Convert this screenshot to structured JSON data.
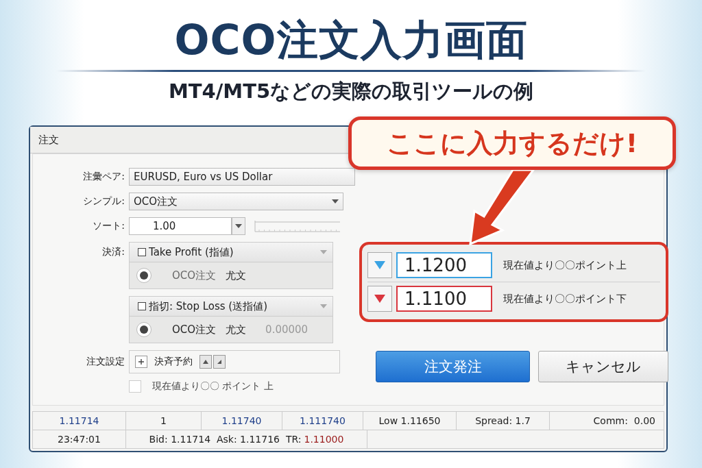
{
  "header": {
    "title": "OCO注文入力画面",
    "subtitle": "MT4/MT5などの実際の取引ツールの例"
  },
  "callout": {
    "text": "ここに入力するだけ!"
  },
  "dialog": {
    "title": "注文",
    "fields": [
      {
        "label": "注彙ペア:",
        "value": "EURUSD, Euro vs US Dollar",
        "kind": "text"
      },
      {
        "label": "シンプル:",
        "value": "OCO注文",
        "kind": "dropdown"
      },
      {
        "label": "ソート:",
        "value": "1.00",
        "kind": "spinner"
      }
    ],
    "settlement": {
      "label": "決済:",
      "groups": [
        {
          "checkbox_label": "Take Profit (指値)",
          "checked": false,
          "radio_selected": true,
          "texts": [
            "OCO注文",
            "尤文"
          ]
        },
        {
          "checkbox_label": "指切: Stop Loss (送指値)",
          "checked": false,
          "radio_selected": true,
          "texts": [
            "OCO注文",
            "尤文",
            "0.00000"
          ]
        }
      ]
    },
    "order_settings": {
      "label": "注文設定",
      "item": "決斉予約",
      "checkbox": {
        "label": "現在値より〇〇 ポイント 上",
        "checked": false
      }
    },
    "oco_prices": [
      {
        "value": "1.1200",
        "note": "現在値より〇〇ポイント上",
        "color": "#3aa3e3"
      },
      {
        "value": "1.1100",
        "note": "現在値より〇〇ポイント下",
        "color": "#d9363e"
      }
    ],
    "buttons": [
      {
        "label": "注文発注",
        "kind": "primary"
      },
      {
        "label": "キャンセル",
        "kind": "secondary"
      }
    ],
    "status_rows": [
      [
        {
          "text": "1.11714",
          "kind": "price"
        },
        {
          "text": "1",
          "kind": "plain"
        },
        {
          "text": "1.11740",
          "kind": "price"
        },
        {
          "text": "1.111740",
          "kind": "price"
        },
        {
          "text": "Low 1.11650",
          "kind": "plain"
        },
        {
          "text": "Spread: 1.7",
          "kind": "plain"
        },
        {
          "text": "Comm:  0.00",
          "kind": "plain"
        }
      ],
      [
        {
          "text": "23:47:01",
          "kind": "plain"
        },
        {
          "text": "Bid: 1.11714  Ask: 1.11716  TR:",
          "kind": "plain",
          "value": "1.11000"
        }
      ]
    ]
  }
}
